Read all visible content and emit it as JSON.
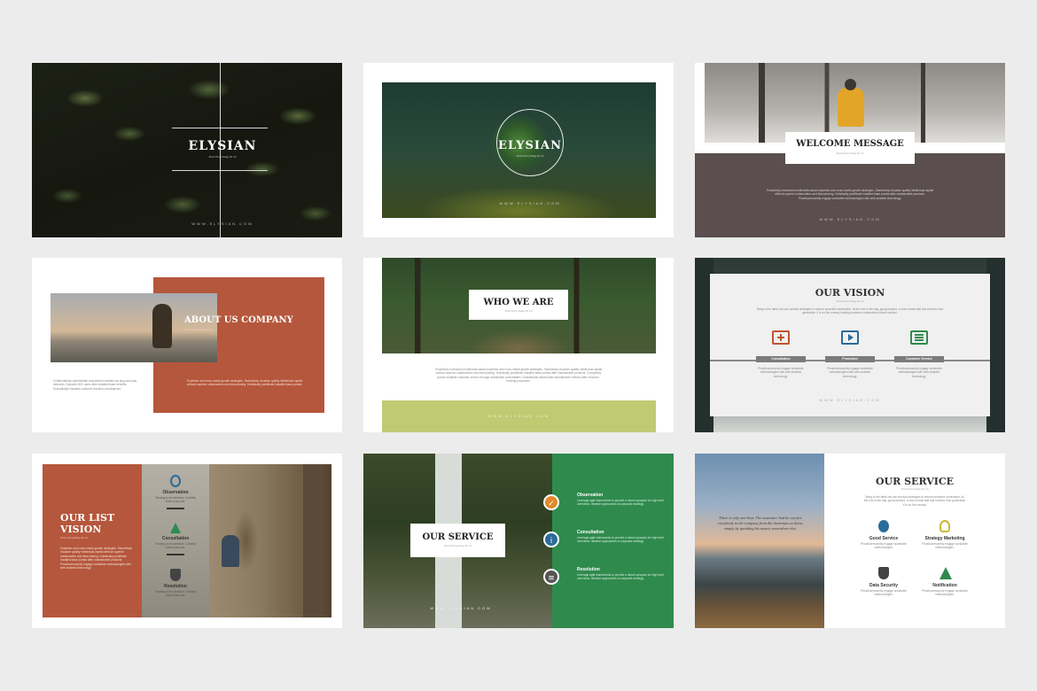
{
  "s1": {
    "brand": "ELYSIAN",
    "tagline": "Trust Everything To Us",
    "url": "WWW.ELYSIAN.COM"
  },
  "s2": {
    "brand": "ELYSIAN",
    "tagline": "Trust Everything To Us",
    "url": "WWW.ELYSIAN.COM"
  },
  "s3": {
    "title": "WELCOME MESSAGE",
    "tagline": "Trust Everything To Us",
    "body": "Proactively envisioned multimedia based expertise and cross-media growth strategies. Seamlessly visualize quality intellectual capital without superior collaboration and idea-sharing. Holistically pontificate installed base portals after maintainable products. Phosfluorescently engage worldwide methodologies with web-enabled technology.",
    "url": "WWW.ELYSIAN.COM"
  },
  "s4": {
    "title": "ABOUT US COMPANY",
    "tagline": "Trust Everything To Us",
    "body_left": "Collaboratively administrate empowered markets via plug-and-play networks. Dynamic B2C users after installed base benefits. Dramatically visualize customer directed convergence.",
    "body_right": "Expertise and cross-media growth strategies. Seamlessly visualize quality intellectual capital without superior collaboration and idea-sharing. Holistically pontificate installed base portals."
  },
  "s5": {
    "title": "WHO WE ARE",
    "tagline": "Trust Everything To Us",
    "body": "Proactively envisioned multimedia based expertise and cross-media growth strategies. Seamlessly visualize quality intellectual capital without superior collaboration and idea-sharing. Holistically pontificate installed base portals after maintainable products. Completely pursue scalable customer service through sustainable potentialities. Dramatically disseminate standardized metrics after resource-leveling processes.",
    "url": "WWW.ELYSIAN.COM"
  },
  "s6": {
    "title": "OUR VISION",
    "tagline": "Trust Everything To Us",
    "intro": "Bring to the table win-win survival strategies to ensure proactive domination. At the end of the day, going forward, a new normal that has evolved from generation X is on the runway heading towards a streamlined cloud solution.",
    "items": [
      {
        "label": "Consultation",
        "text": "Phosfluorescently engage worldwide methodologies with web-enabled technology."
      },
      {
        "label": "Promotion",
        "text": "Phosfluorescently engage worldwide methodologies with web-enabled technology."
      },
      {
        "label": "Customer Service",
        "text": "Phosfluorescently engage worldwide methodologies with web-enabled technology."
      }
    ],
    "url": "WWW.ELYSIAN.COM"
  },
  "s7": {
    "title_line1": "OUR LIST",
    "title_line2": "VISION",
    "tagline": "Trust Everything To Us",
    "body": "Expertise and cross-media growth strategies. Seamlessly visualize quality intellectual capital without superior collaboration and idea-sharing. Holistically pontificate installed base portals after maintainable products. Phosfluorescently engage worldwide methodologies with web-enabled technology.",
    "items": [
      {
        "label": "Observation",
        "text": "Tending to be selective. Credibly build cross-unit."
      },
      {
        "label": "Consultation",
        "text": "Tending to be selective. Credibly build cross-unit."
      },
      {
        "label": "Resolution",
        "text": "Tending to be selective. Credibly build cross-unit."
      }
    ]
  },
  "s8": {
    "title": "OUR SERVICE",
    "tagline": "Trust Everything To Us",
    "url": "WWW.ELYSIAN.COM",
    "items": [
      {
        "label": "Observation",
        "text": "Leverage agile frameworks to provide a robust synopsis for high level overviews. Iterative approaches to corporate strategy."
      },
      {
        "label": "Consultation",
        "text": "Leverage agile frameworks to provide a robust synopsis for high level overviews. Iterative approaches to corporate strategy."
      },
      {
        "label": "Resolution",
        "text": "Leverage agile frameworks to provide a robust synopsis for high level overviews. Iterative approaches to corporate strategy."
      }
    ]
  },
  "s9": {
    "title": "OUR SERVICE",
    "tagline": "Trust Everything To Us",
    "quote": "There is only one boss. The customer. And he can fire everybody in the company from the chairman on down, simply by spending his money somewhere else.",
    "intro": "Bring to the table win-win survival strategies to ensure proactive domination. At the end of the day, going forward, a new normal that has evolved from generation X is on the runway.",
    "items": [
      {
        "label": "Good Service",
        "text": "Phosfluorescently engage worldwide methodologies."
      },
      {
        "label": "Strategy Marketing",
        "text": "Phosfluorescently engage worldwide methodologies."
      },
      {
        "label": "Data Security",
        "text": "Phosfluorescently engage worldwide methodologies."
      },
      {
        "label": "Notification",
        "text": "Phosfluorescently engage worldwide methodologies."
      }
    ]
  },
  "colors": {
    "rust": "#b5573c",
    "taupe": "#5a4e4e",
    "lime": "#bfcb72",
    "green": "#2f8a4e",
    "gray_bg": "#ececec"
  },
  "icons": [
    "plus-monitor-icon",
    "play-icon",
    "list-icon",
    "drop-icon",
    "bulb-icon",
    "shield-icon",
    "tree-icon",
    "checklist-icon",
    "info-icon",
    "clipboard-icon"
  ]
}
